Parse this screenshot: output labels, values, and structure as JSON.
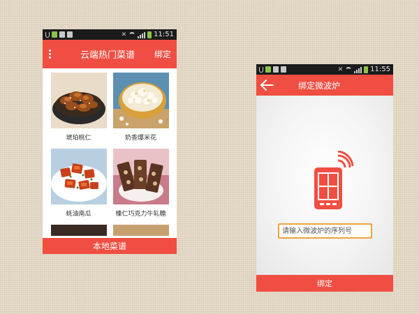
{
  "left_screen": {
    "status_bar": {
      "time": "11:51"
    },
    "app_bar": {
      "title": "云端热门菜谱",
      "action_label": "绑定"
    },
    "recipes": [
      {
        "name": "琥珀桃仁",
        "thumb": "caramel-walnuts-image"
      },
      {
        "name": "奶香爆米花",
        "thumb": "popcorn-image"
      },
      {
        "name": "蚝油南瓜",
        "thumb": "oyster-sauce-pumpkin-image"
      },
      {
        "name": "榛仁巧克力牛轧糖",
        "thumb": "hazelnut-chocolate-nougat-image"
      }
    ],
    "bottom_button": {
      "label": "本地菜谱"
    }
  },
  "right_screen": {
    "status_bar": {
      "time": "11:55"
    },
    "app_bar": {
      "title": "绑定微波炉"
    },
    "serial_input": {
      "placeholder": "请输入微波炉的序列号",
      "value": ""
    },
    "bottom_button": {
      "label": "绑定"
    }
  },
  "colors": {
    "accent": "#f04e42",
    "input_border": "#f0a33a",
    "status_bar": "#1b1b1b"
  }
}
